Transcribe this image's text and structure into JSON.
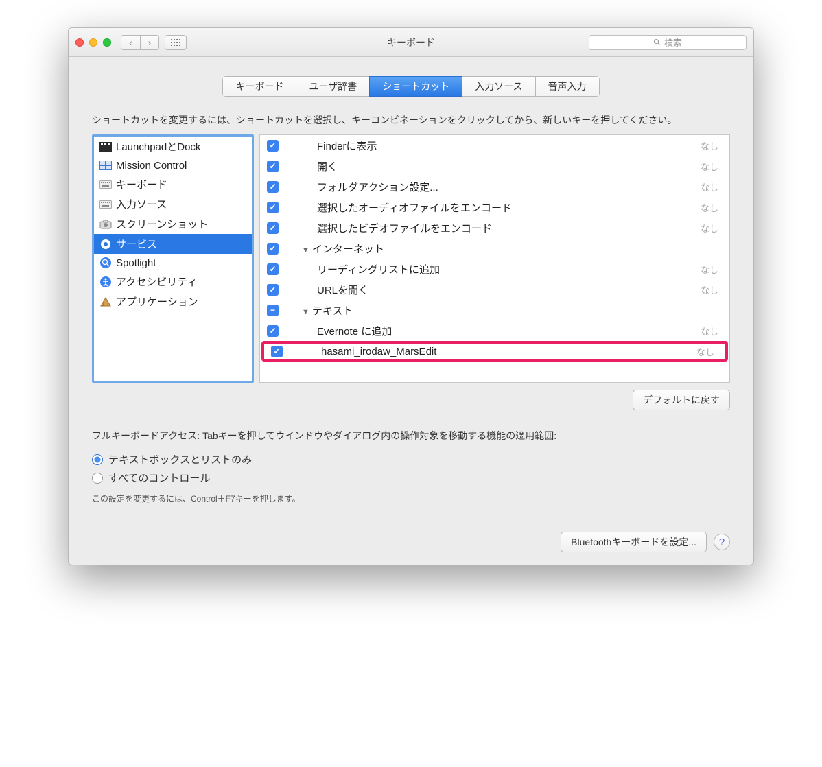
{
  "window": {
    "title": "キーボード"
  },
  "search": {
    "placeholder": "検索"
  },
  "tabs": [
    {
      "label": "キーボード"
    },
    {
      "label": "ユーザ辞書"
    },
    {
      "label": "ショートカット",
      "selected": true
    },
    {
      "label": "入力ソース"
    },
    {
      "label": "音声入力"
    }
  ],
  "instruction": "ショートカットを変更するには、ショートカットを選択し、キーコンビネーションをクリックしてから、新しいキーを押してください。",
  "sidebar": [
    {
      "label": "LaunchpadとDock",
      "icon": "launchpad"
    },
    {
      "label": "Mission Control",
      "icon": "mission"
    },
    {
      "label": "キーボード",
      "icon": "keyboard"
    },
    {
      "label": "入力ソース",
      "icon": "keyboard"
    },
    {
      "label": "スクリーンショット",
      "icon": "screenshot"
    },
    {
      "label": "サービス",
      "icon": "gear",
      "selected": true
    },
    {
      "label": "Spotlight",
      "icon": "spotlight"
    },
    {
      "label": "アクセシビリティ",
      "icon": "accessibility"
    },
    {
      "label": "アプリケーション",
      "icon": "app"
    }
  ],
  "detail": [
    {
      "checked": true,
      "indent": 2,
      "label": "Finderに表示",
      "shortcut": "なし"
    },
    {
      "checked": true,
      "indent": 2,
      "label": "開く",
      "shortcut": "なし"
    },
    {
      "checked": true,
      "indent": 2,
      "label": "フォルダアクション設定...",
      "shortcut": "なし"
    },
    {
      "checked": true,
      "indent": 2,
      "label": "選択したオーディオファイルをエンコード",
      "shortcut": "なし"
    },
    {
      "checked": true,
      "indent": 2,
      "label": "選択したビデオファイルをエンコード",
      "shortcut": "なし"
    },
    {
      "checked": true,
      "indent": 1,
      "label": "インターネット",
      "group": true,
      "tri": true
    },
    {
      "checked": true,
      "indent": 2,
      "label": "リーディングリストに追加",
      "shortcut": "なし"
    },
    {
      "checked": true,
      "indent": 2,
      "label": "URLを開く",
      "shortcut": "なし"
    },
    {
      "mixed": true,
      "indent": 1,
      "label": "テキスト",
      "group": true,
      "tri": true
    },
    {
      "checked": true,
      "indent": 2,
      "label": "Evernote に追加",
      "shortcut": "なし"
    },
    {
      "checked": true,
      "indent": 2,
      "label": "hasami_irodaw_MarsEdit",
      "shortcut": "なし",
      "highlight": true
    }
  ],
  "restore_button": "デフォルトに戻す",
  "full_access_text": "フルキーボードアクセス: Tabキーを押してウインドウやダイアログ内の操作対象を移動する機能の適用範囲:",
  "radios": [
    {
      "label": "テキストボックスとリストのみ",
      "checked": true
    },
    {
      "label": "すべてのコントロール",
      "checked": false
    }
  ],
  "hint_text": "この設定を変更するには、Control＋F7キーを押します。",
  "bluetooth_button": "Bluetoothキーボードを設定..."
}
